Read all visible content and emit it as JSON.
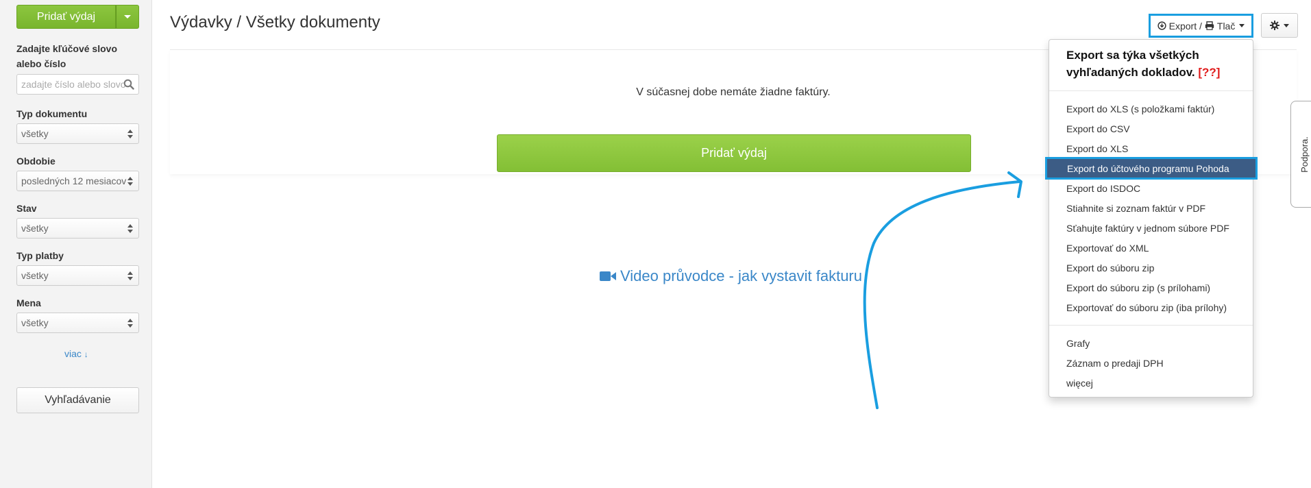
{
  "sidebar": {
    "add_button_label": "Pridať výdaj",
    "keyword_label": "Zadajte kľúčové slovo alebo číslo",
    "keyword_placeholder": "zadajte číslo alebo slovo",
    "doc_type_label": "Typ dokumentu",
    "doc_type_value": "všetky",
    "period_label": "Obdobie",
    "period_value": "posledných 12 mesiacov",
    "status_label": "Stav",
    "status_value": "všetky",
    "payment_type_label": "Typ platby",
    "payment_type_value": "všetky",
    "currency_label": "Mena",
    "currency_value": "všetky",
    "more_label": "viac",
    "search_button_label": "Vyhľadávanie"
  },
  "header": {
    "title": "Výdavky / Všetky dokumenty",
    "export_label": "Export / ",
    "print_label": "Tlač"
  },
  "main": {
    "empty_message": "V súčasnej dobe nemáte žiadne faktúry.",
    "add_button_label": "Pridať výdaj",
    "video_link": "Video průvodce - jak vystavit fakturu"
  },
  "dropdown": {
    "header": "Export sa týka všetkých vyhľadaných dokladov.",
    "header_help": "[??]",
    "items": [
      "Export do XLS (s položkami faktúr)",
      "Export do CSV",
      "Export do XLS",
      "Export do účtového programu Pohoda",
      "Export do ISDOC",
      "Stiahnite si zoznam faktúr v PDF",
      "Sťahujte faktúry v jednom súbore PDF",
      "Exportovať do XML",
      "Export do súboru zip",
      "Export do súboru zip (s prílohami)",
      "Exportovať do súboru zip (iba prílohy)"
    ],
    "extra_items": [
      "Grafy",
      "Záznam o predaji DPH",
      "więcej"
    ]
  },
  "support_tab_label": "Podpora.",
  "colors": {
    "accent_green": "#8cc63f",
    "link_blue": "#3a87c8",
    "highlight_frame": "#1a9ee0",
    "active_item_bg": "#3c5c85"
  }
}
